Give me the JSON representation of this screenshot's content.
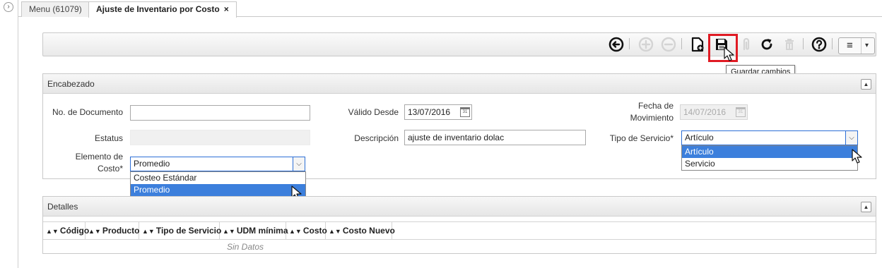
{
  "tabs": [
    {
      "label": "Menu (61079)"
    },
    {
      "label": "Ajuste de Inventario por Costo",
      "close": "×"
    }
  ],
  "gutter": {
    "collapse_icon": "›"
  },
  "toolbar": {
    "tooltip": "Guardar cambios",
    "menu_icon": "≡",
    "menu_caret": "▾"
  },
  "encabezado": {
    "title": "Encabezado",
    "toggle": "▲",
    "fields": {
      "no_documento": {
        "label": "No. de Documento",
        "value": ""
      },
      "estatus": {
        "label": "Estatus",
        "value": ""
      },
      "elemento_costo": {
        "label_line1": "Elemento de",
        "label_line2": "Costo*",
        "value": "Promedio"
      },
      "valido_desde": {
        "label": "Válido Desde",
        "value": "13/07/2016"
      },
      "descripcion": {
        "label": "Descripción",
        "value": "ajuste de inventario dolac"
      },
      "fecha_movimiento": {
        "label_line1": "Fecha de",
        "label_line2": "Movimiento",
        "value": "14/07/2016"
      },
      "tipo_servicio": {
        "label": "Tipo de Servicio*",
        "value": "Artículo"
      }
    },
    "elemento_costo_options": [
      "Costeo Estándar",
      "Promedio"
    ],
    "tipo_servicio_options": [
      "Artículo",
      "Servicio"
    ]
  },
  "detalles": {
    "title": "Detalles",
    "toggle": "▲",
    "columns": [
      "Código",
      "Producto",
      "Tipo de Servicio",
      "UDM mínima",
      "Costo",
      "Costo Nuevo"
    ],
    "empty_text": "Sin Datos"
  },
  "colors": {
    "accent": "#3c7fdc",
    "highlight": "#e01b24"
  }
}
